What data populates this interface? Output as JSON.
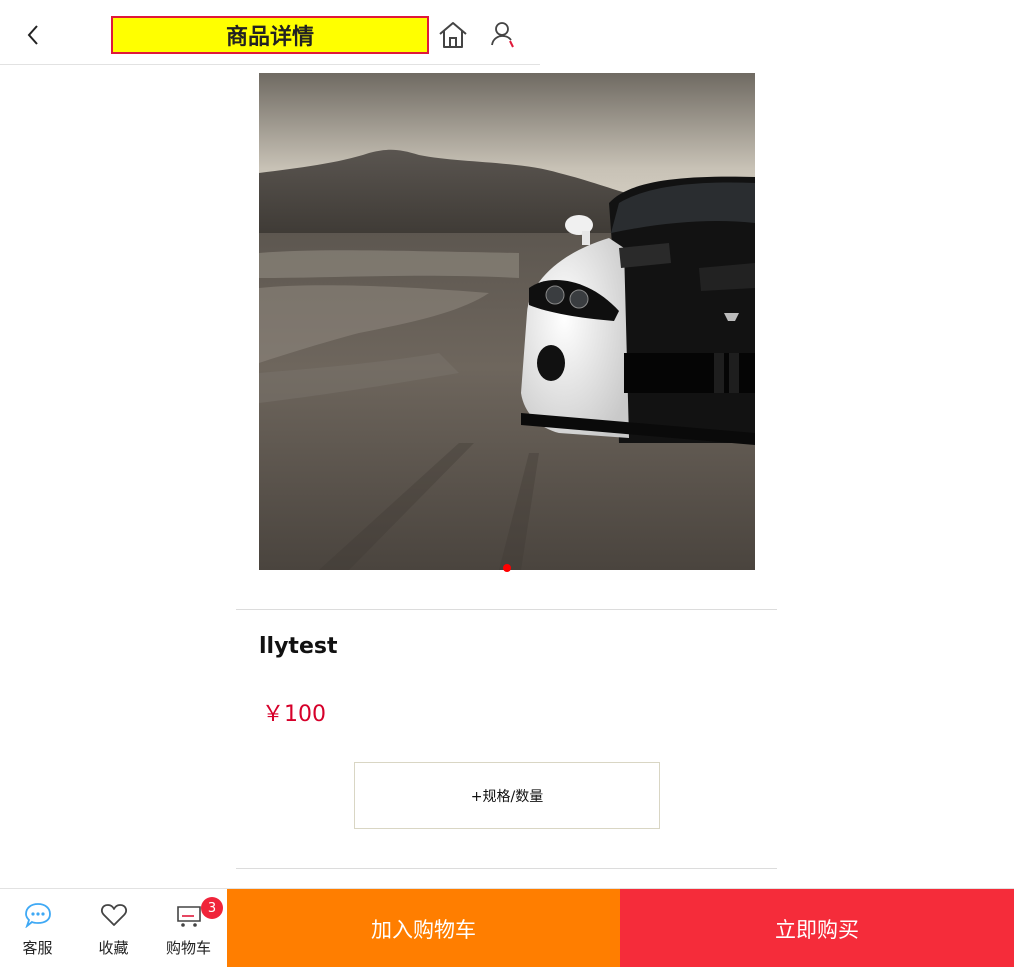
{
  "header": {
    "title": "商品详情",
    "back_icon": "chevron-left-icon",
    "home_icon": "home-icon",
    "user_icon": "user-icon"
  },
  "product": {
    "image_subject": "white and black sports car in desert",
    "name": "llytest",
    "price": "￥100",
    "spec_button_label": "+规格/数量",
    "carousel_active_index": 0,
    "carousel_count": 1
  },
  "bottom_bar": {
    "service_label": "客服",
    "favorite_label": "收藏",
    "cart_label": "购物车",
    "cart_count": "3",
    "add_to_cart_label": "加入购物车",
    "buy_now_label": "立即购买"
  },
  "colors": {
    "title_bg": "#ffff00",
    "title_border": "#e0193a",
    "price": "#d6002a",
    "add_to_cart_bg": "#ff7e00",
    "buy_now_bg": "#f52c3a",
    "badge_bg": "#f0243a",
    "carousel_dot": "#ff0000",
    "service_icon": "#3fa9f5"
  }
}
